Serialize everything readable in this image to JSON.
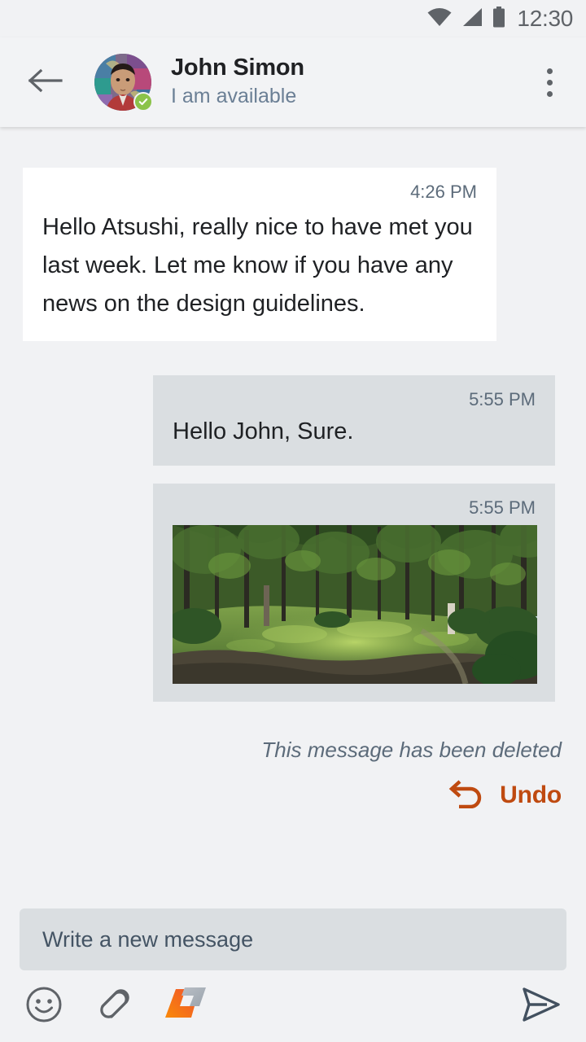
{
  "status_bar": {
    "clock": "12:30",
    "icons": [
      "wifi-icon",
      "cellular-signal-icon",
      "battery-icon"
    ]
  },
  "header": {
    "back_icon": "back-arrow-icon",
    "contact_name": "John Simon",
    "contact_status": "I am available",
    "presence_icon": "check-badge-icon",
    "overflow_icon": "overflow-menu-icon",
    "avatar_alt": "contact-avatar"
  },
  "messages": [
    {
      "direction": "incoming",
      "time": "4:26 PM",
      "text": "Hello Atsushi, really nice to have met you last week. Let me know if you have any news on the design guidelines."
    },
    {
      "direction": "outgoing",
      "time": "5:55 PM",
      "text": "Hello John, Sure."
    },
    {
      "direction": "outgoing",
      "time": "5:55 PM",
      "attachment": "forest-clearing-photo"
    }
  ],
  "deleted": {
    "notice": "This message has been deleted",
    "undo_label": "Undo",
    "undo_icon": "undo-arrow-icon",
    "undo_color": "#bf4a10"
  },
  "composer": {
    "placeholder": "Write a new message",
    "tools": [
      {
        "name": "emoji-icon",
        "label": "Emoji"
      },
      {
        "name": "attachment-icon",
        "label": "Attach"
      },
      {
        "name": "app-logo-icon",
        "label": "App"
      }
    ],
    "send_icon": "send-icon",
    "send_label": "Send"
  },
  "colors": {
    "background": "#f1f2f4",
    "incoming_bubble": "#ffffff",
    "outgoing_bubble": "#dadee1",
    "accent": "#bf4a10",
    "presence": "#8bc34a",
    "muted_text": "#5c6b7a"
  }
}
